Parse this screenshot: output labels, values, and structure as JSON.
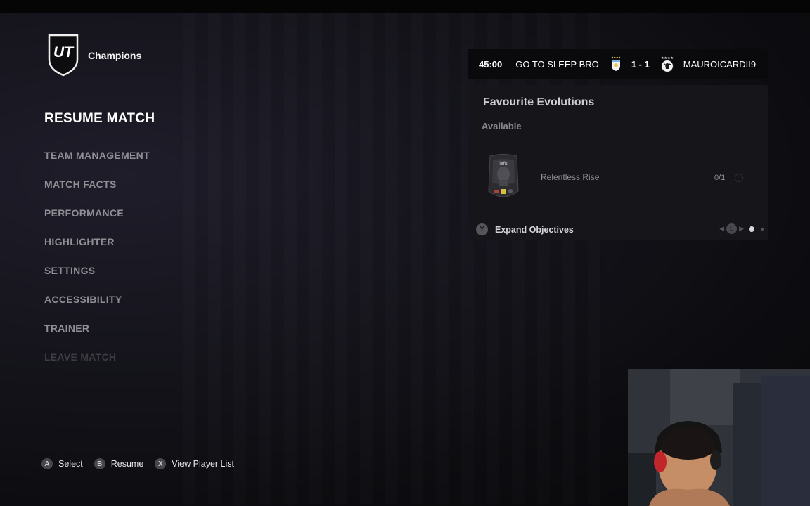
{
  "header": {
    "mode_title": "Champions",
    "logo_text": "UT"
  },
  "menu": {
    "items": [
      {
        "label": "RESUME MATCH",
        "state": "active"
      },
      {
        "label": "TEAM MANAGEMENT",
        "state": "normal"
      },
      {
        "label": "MATCH FACTS",
        "state": "normal"
      },
      {
        "label": "PERFORMANCE",
        "state": "normal"
      },
      {
        "label": "HIGHLIGHTER",
        "state": "normal"
      },
      {
        "label": "SETTINGS",
        "state": "normal"
      },
      {
        "label": "ACCESSIBILITY",
        "state": "normal"
      },
      {
        "label": "TRAINER",
        "state": "normal"
      },
      {
        "label": "LEAVE MATCH",
        "state": "disabled"
      }
    ]
  },
  "scoreboard": {
    "clock": "45:00",
    "home_team": "GO TO SLEEP BRO",
    "score": "1 - 1",
    "away_team": "MAUROICARDII9",
    "home_crest_icon": "uruguay-crest-icon",
    "away_crest_icon": "germany-crest-icon"
  },
  "evolutions": {
    "title": "Favourite Evolutions",
    "subtitle": "Available",
    "item": {
      "name": "Relentless Rise",
      "progress": "0/1",
      "card_icon": "player-card-icon",
      "card_text": "lefu"
    },
    "footer": {
      "button": "Y",
      "label": "Expand Objectives",
      "pager_button": "L"
    }
  },
  "hints": [
    {
      "button": "A",
      "label": "Select"
    },
    {
      "button": "B",
      "label": "Resume"
    },
    {
      "button": "X",
      "label": "View Player List"
    }
  ],
  "colors": {
    "background": "#16151d",
    "accent_text": "#ffffff",
    "muted_text": "#8f8f95",
    "panel": "#16161a"
  }
}
